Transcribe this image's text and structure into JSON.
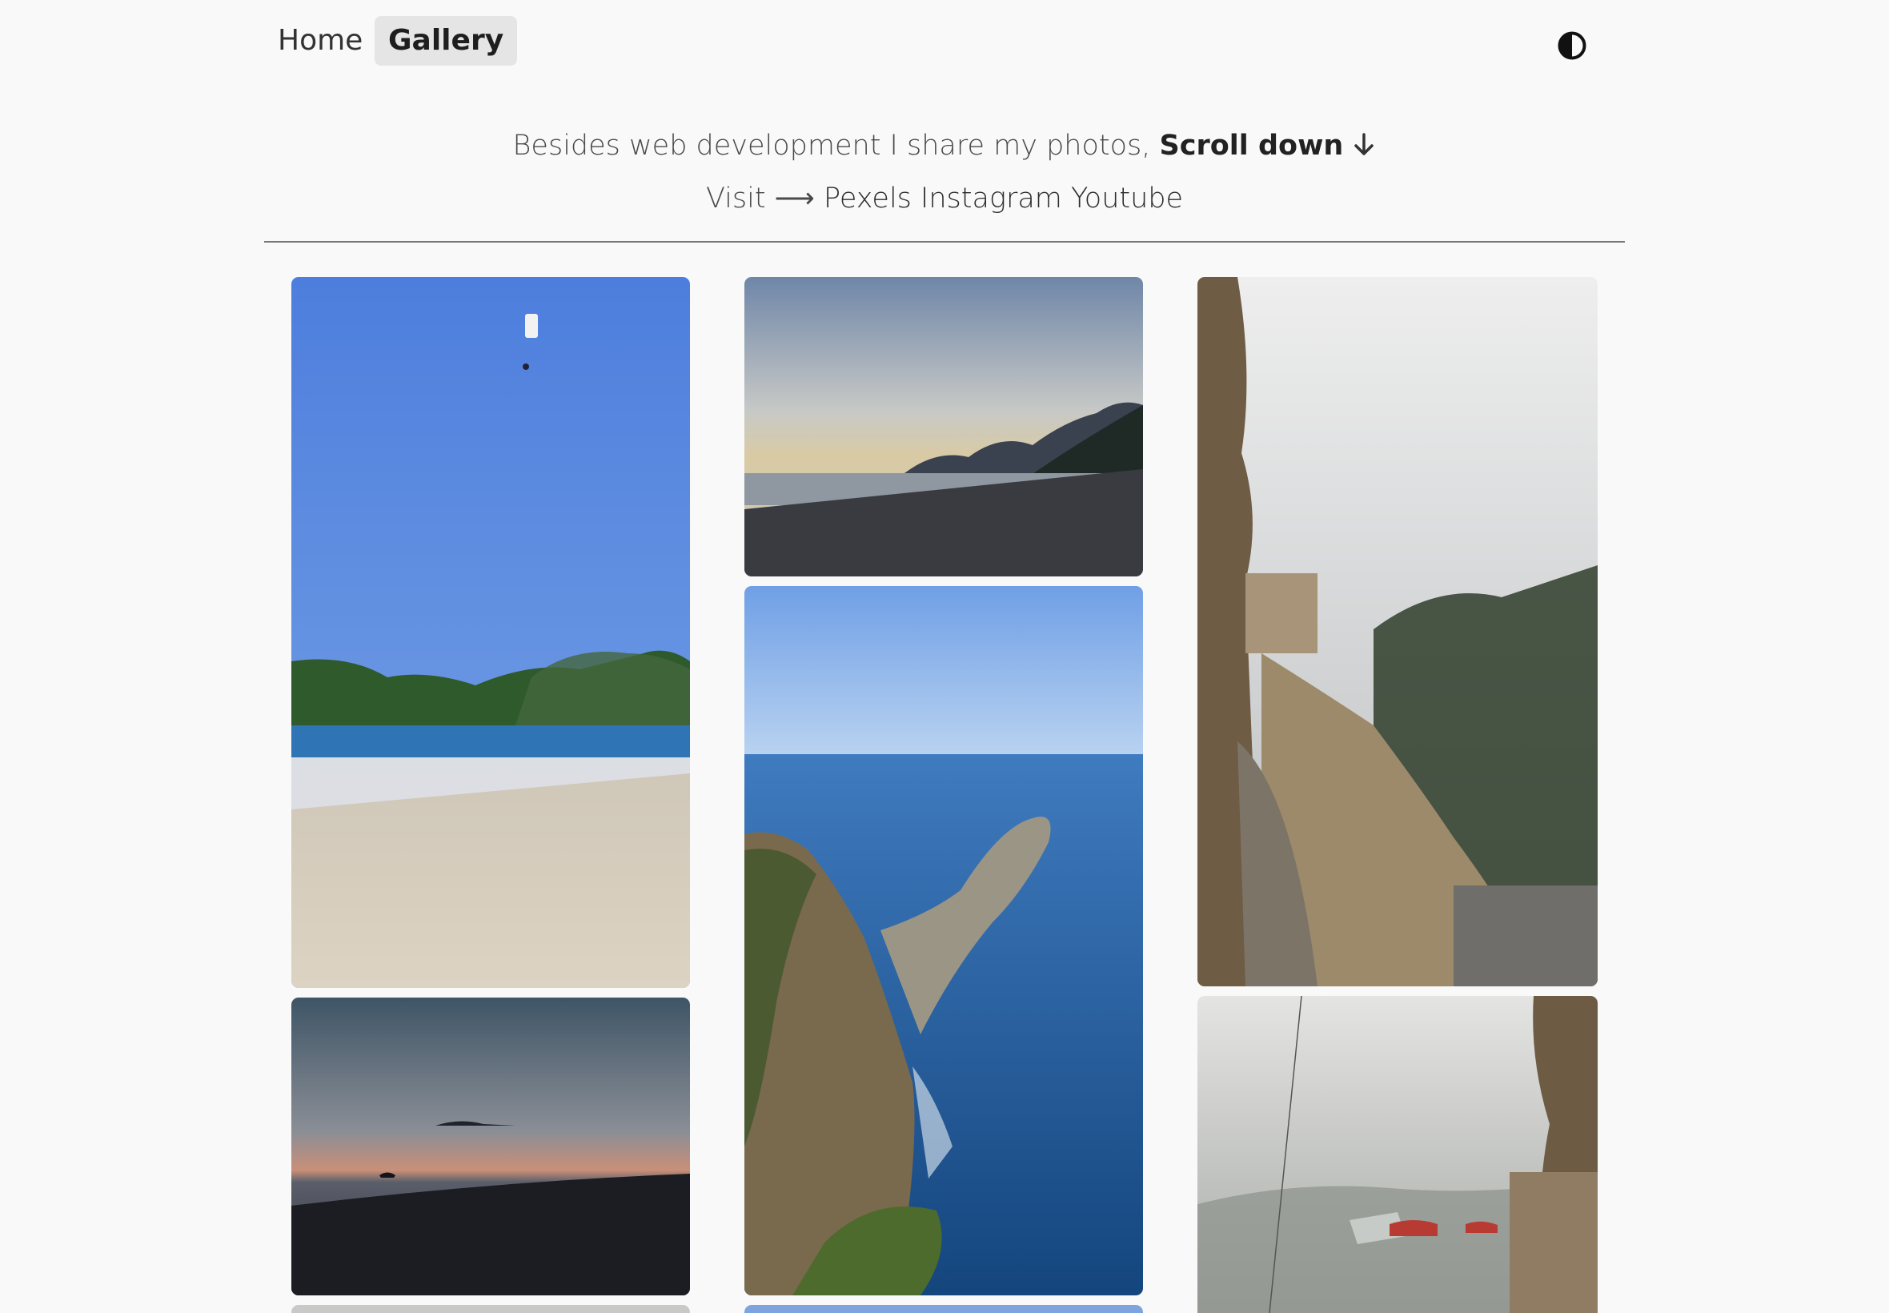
{
  "nav": {
    "home_label": "Home",
    "gallery_label": "Gallery",
    "active": "Gallery"
  },
  "theme_toggle": {
    "icon": "contrast-icon"
  },
  "intro": {
    "text": "Besides web development I share my photos,",
    "emphasis": "Scroll down",
    "arrow_icon": "arrow-down-icon",
    "visit_label": "Visit ⟶",
    "links": [
      "Pexels",
      "Instagram",
      "Youtube"
    ]
  },
  "gallery": {
    "photos": [
      {
        "subject": "beach with paraglider"
      },
      {
        "subject": "beach at sunset"
      },
      {
        "subject": "coast with mountains at dusk"
      },
      {
        "subject": "cliffs over the sea"
      },
      {
        "subject": "monastery stairs in fog"
      },
      {
        "subject": "foggy valley with red roofs"
      }
    ]
  },
  "colors": {
    "background": "#f8f9f8",
    "active_tab": "#e4e5e4",
    "divider": "#777777"
  }
}
